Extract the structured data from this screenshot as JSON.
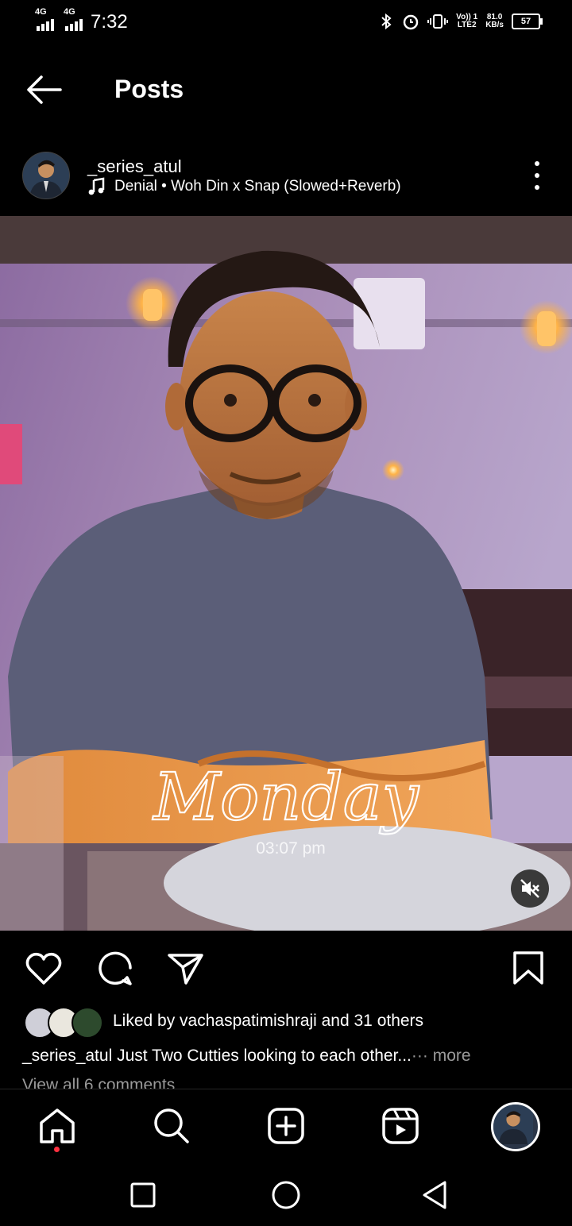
{
  "status_bar": {
    "sim1": "4G",
    "sim2": "4G",
    "time": "7:32",
    "volte": "Vo)) 1",
    "lte": "LTE2",
    "net_speed": "81.0",
    "net_unit": "KB/s",
    "battery": "57"
  },
  "header": {
    "title": "Posts"
  },
  "post": {
    "username": "_series_atul",
    "music": "Denial • Woh Din x Snap (Slowed+Reverb)",
    "sticker_day": "Monday",
    "sticker_time": "03:07 pm",
    "likes_text": "Liked by vachaspatimishraji and 31 others",
    "caption_user": "_series_atul",
    "caption_text": " Just Two Cutties looking to each other...",
    "caption_more": "··· more",
    "comments_link": "View all 6 comments"
  },
  "icons": {
    "back": "arrow-left-icon",
    "more": "more-vertical-icon",
    "music": "music-note-icon",
    "like": "heart-icon",
    "comment": "comment-icon",
    "share": "send-icon",
    "save": "bookmark-icon",
    "mute": "speaker-muted-icon",
    "home": "home-icon",
    "search": "search-icon",
    "create": "add-square-icon",
    "reels": "reels-icon",
    "recent": "square-icon",
    "sys_home": "circle-icon",
    "sys_back": "triangle-back-icon"
  },
  "colors": {
    "background": "#000000",
    "text": "#ffffff",
    "muted": "#9a9a9a",
    "notification_dot": "#ff3040"
  }
}
